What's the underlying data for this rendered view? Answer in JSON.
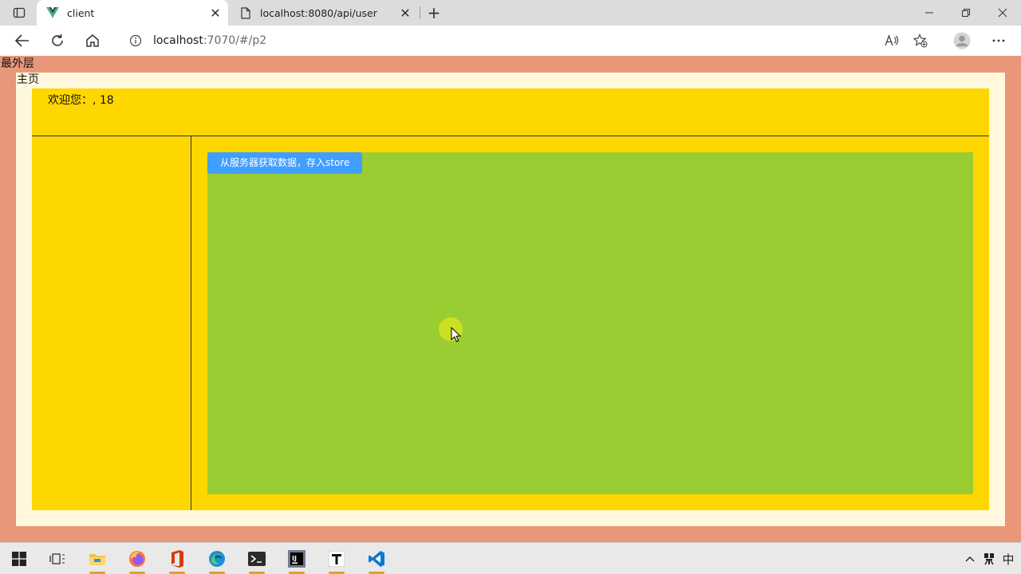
{
  "browser": {
    "tabs": [
      {
        "title": "client",
        "favicon": "vue-logo-icon",
        "active": true
      },
      {
        "title": "localhost:8080/api/user",
        "favicon": "document-icon",
        "active": false
      }
    ],
    "address": {
      "host": "localhost",
      "rest": ":7070/#/p2"
    }
  },
  "page": {
    "outer_label": "最外层",
    "home_label": "主页",
    "welcome_text": "欢迎您：, 18",
    "fetch_button_label": "从服务器获取数据，存入store",
    "colors": {
      "outer_bg": "#e8977a",
      "home_bg": "#fff8dc",
      "app_bg": "#ffd700",
      "main_bg": "#9acd32",
      "button_bg": "#409eff"
    }
  },
  "taskbar": {
    "apps": [
      "windows-start-icon",
      "task-view-icon",
      "file-explorer-icon",
      "firefox-icon",
      "office-icon",
      "edge-icon",
      "terminal-icon",
      "intellij-icon",
      "typora-icon",
      "vscode-icon"
    ],
    "ime_label": "中"
  }
}
